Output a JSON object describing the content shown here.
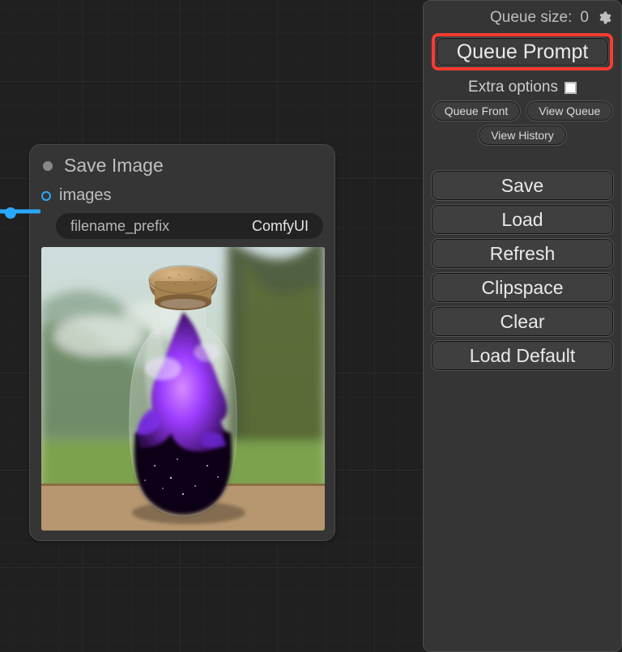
{
  "panel": {
    "queue_size_label": "Queue size:",
    "queue_size_value": "0",
    "queue_prompt": "Queue Prompt",
    "extra_options": "Extra options",
    "queue_front": "Queue Front",
    "view_queue": "View Queue",
    "view_history": "View History",
    "save": "Save",
    "load": "Load",
    "refresh": "Refresh",
    "clipspace": "Clipspace",
    "clear": "Clear",
    "load_default": "Load Default"
  },
  "node": {
    "title": "Save Image",
    "port_label": "images",
    "widget_label": "filename_prefix",
    "widget_value": "ComfyUI"
  },
  "colors": {
    "accent": "#2aa8ff",
    "highlight": "#ff3b30"
  },
  "icons": {
    "gear": "gear-icon",
    "collapse": "collapse-dot-icon"
  }
}
